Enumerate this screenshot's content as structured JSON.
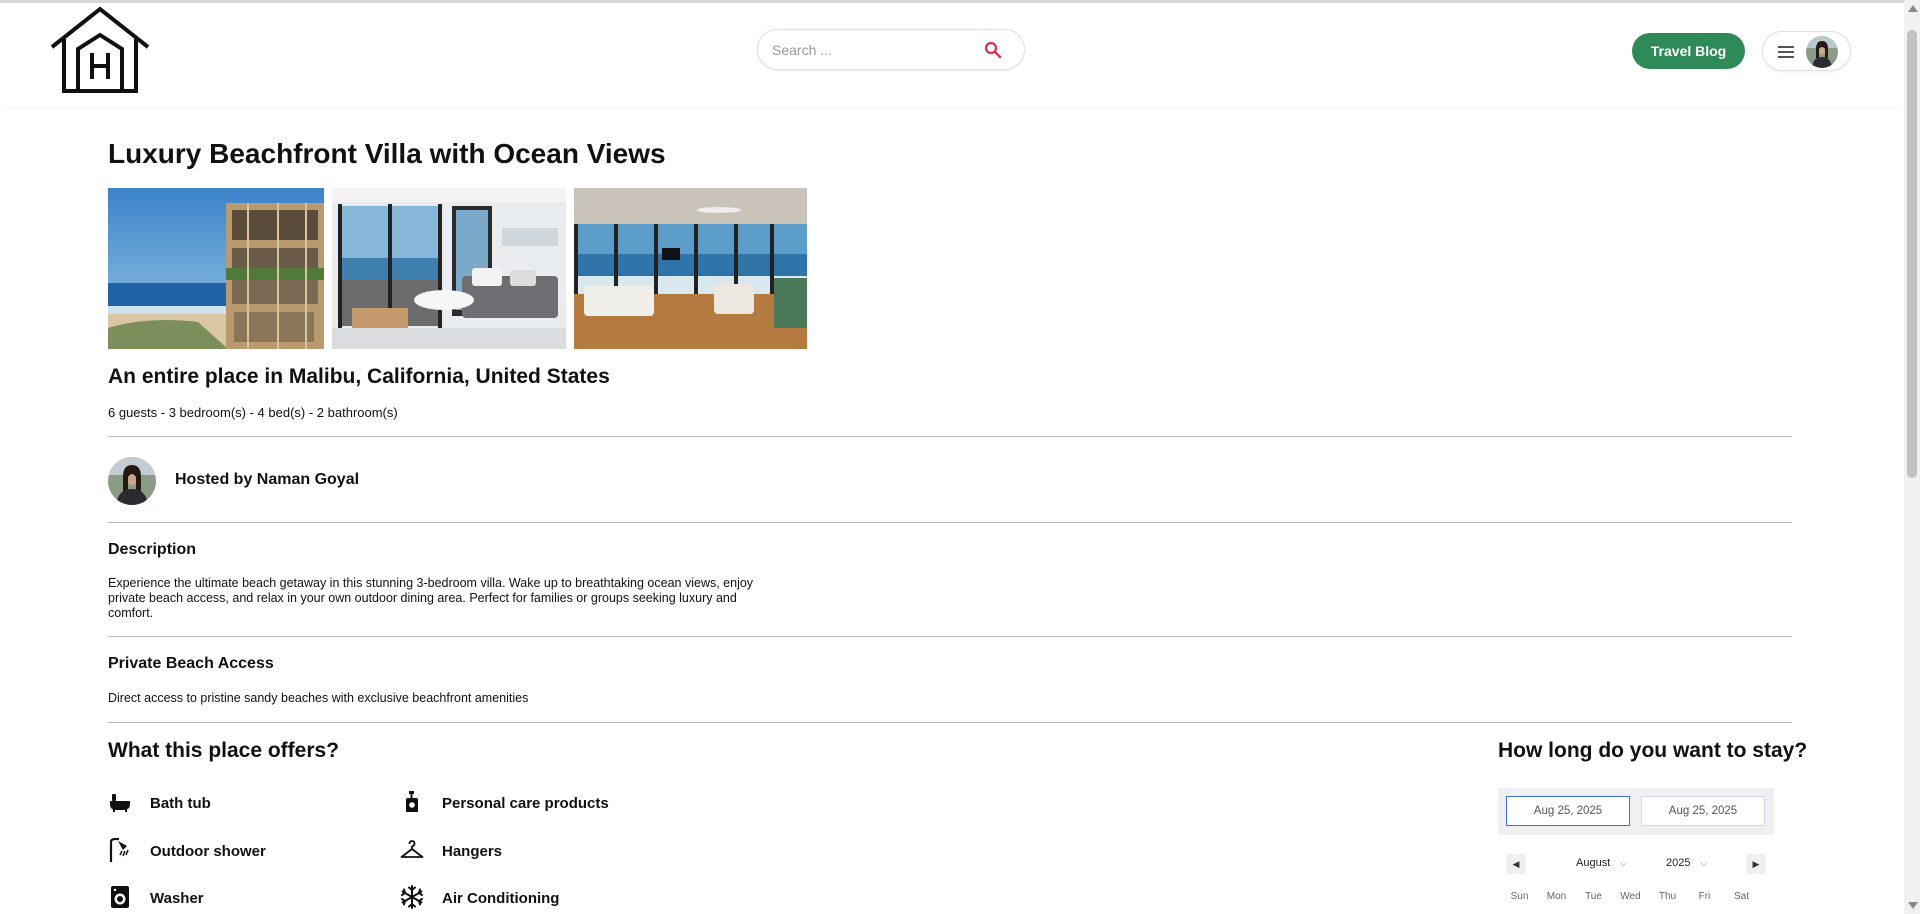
{
  "header": {
    "logo_icon": "house-h-logo",
    "search": {
      "placeholder": "Search ...",
      "icon": "search-icon",
      "accent": "#e0314f"
    },
    "blog_button": "Travel Blog",
    "blog_color": "#2e8b57",
    "menu_icon": "hamburger-menu-icon"
  },
  "listing": {
    "title": "Luxury Beachfront Villa with Ocean Views",
    "photos": [
      "beachfront-building",
      "living-room-balcony",
      "ocean-view-lounge"
    ],
    "subtitle": "An entire place in Malibu, California, United States",
    "stats": "6 guests - 3 bedroom(s) - 4 bed(s) - 2 bathroom(s)",
    "host": "Hosted by Naman Goyal",
    "description_heading": "Description",
    "description": "Experience the ultimate beach getaway in this stunning 3-bedroom villa. Wake up to breathtaking ocean views, enjoy private beach access, and relax in your own outdoor dining area. Perfect for families or groups seeking luxury and comfort.",
    "feature_heading": "Private Beach Access",
    "feature_text": "Direct access to pristine sandy beaches with exclusive beachfront amenities"
  },
  "offers": {
    "heading": "What this place offers?",
    "items": [
      {
        "label": "Bath tub",
        "icon": "bathtub-icon"
      },
      {
        "label": "Personal care products",
        "icon": "soap-bottle-icon"
      },
      {
        "label": "Outdoor shower",
        "icon": "shower-icon"
      },
      {
        "label": "Hangers",
        "icon": "hanger-icon"
      },
      {
        "label": "Washer",
        "icon": "washer-icon"
      },
      {
        "label": "Air Conditioning",
        "icon": "snowflake-icon"
      }
    ]
  },
  "stay": {
    "heading": "How long do you want to stay?",
    "start_date": "Aug 25, 2025",
    "end_date": "Aug 25, 2025",
    "month": "August",
    "year": "2025",
    "weekdays": [
      "Sun",
      "Mon",
      "Tue",
      "Wed",
      "Thu",
      "Fri",
      "Sat"
    ]
  }
}
